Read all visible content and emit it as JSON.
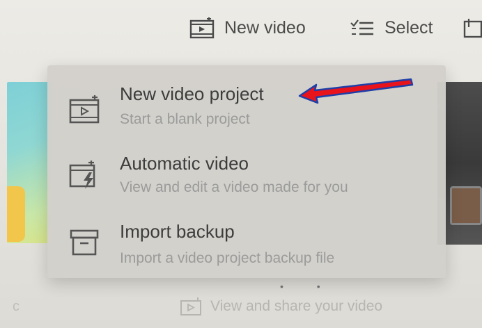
{
  "toolbar": {
    "new_video_label": "New video",
    "select_label": "Select"
  },
  "menu": {
    "items": [
      {
        "title": "New video project",
        "subtitle": "Start a blank project",
        "icon": "video-project-icon"
      },
      {
        "title": "Automatic video",
        "subtitle": "View and edit a video made for you",
        "icon": "automatic-video-icon"
      },
      {
        "title": "Import backup",
        "subtitle": "Import a video project backup file",
        "icon": "archive-box-icon"
      }
    ]
  },
  "bottom": {
    "hint_label": "View and share your video",
    "left_fragment": "c"
  },
  "annotation": {
    "arrow_color": "#e8131b",
    "arrow_outline": "#1f3fa8"
  }
}
